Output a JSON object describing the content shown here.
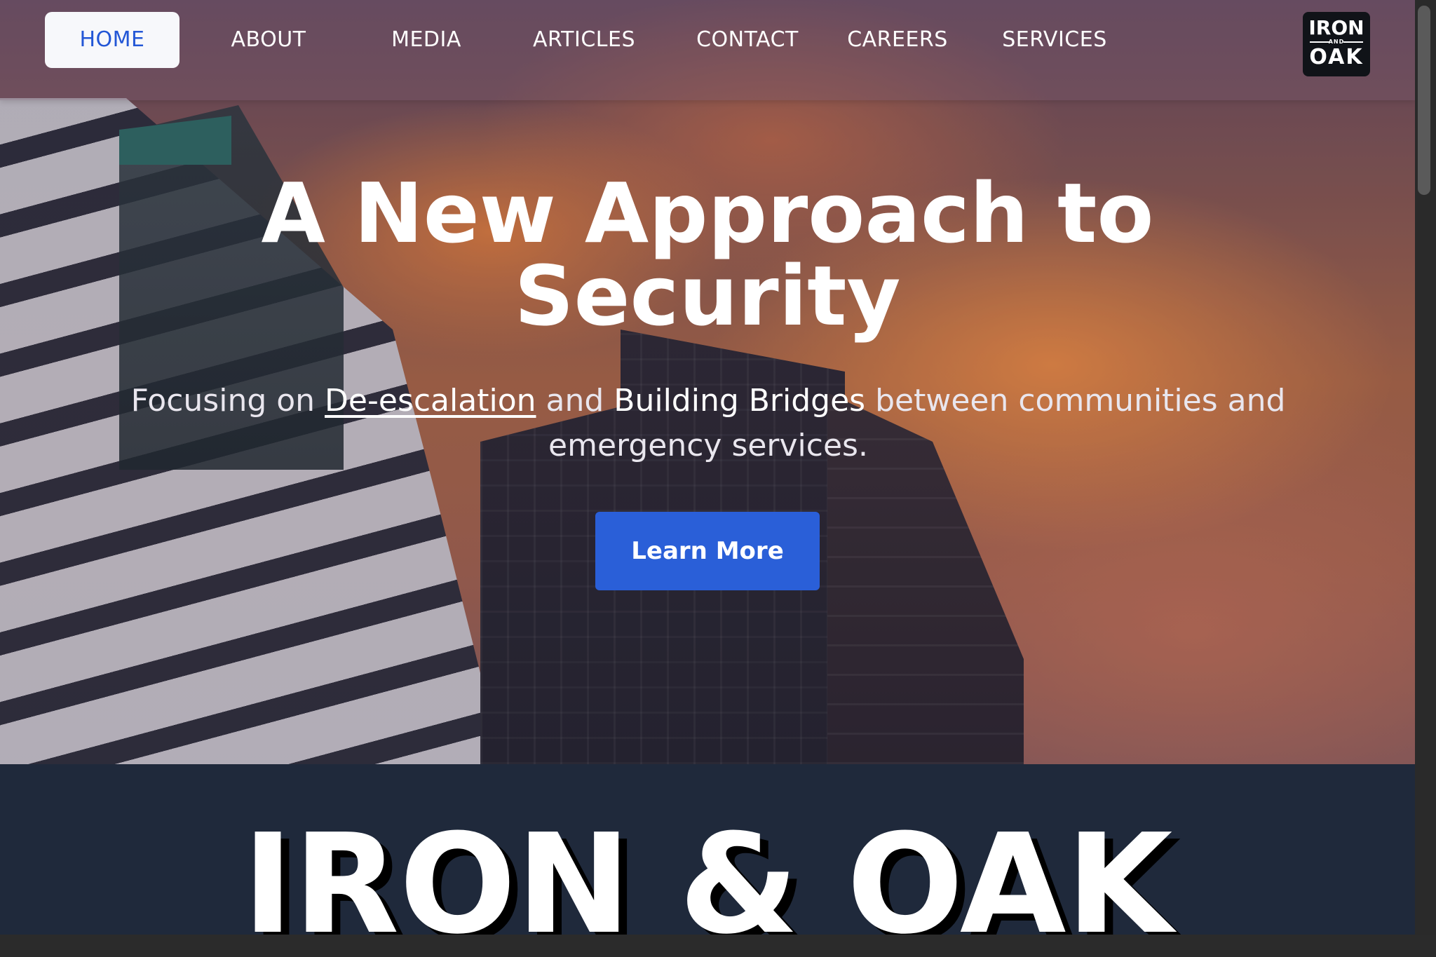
{
  "nav": {
    "items": [
      {
        "label": "HOME",
        "active": true
      },
      {
        "label": "ABOUT"
      },
      {
        "label": "MEDIA"
      },
      {
        "label": "ARTICLES"
      },
      {
        "label": "CONTACT"
      },
      {
        "label": "CAREERS"
      },
      {
        "label": "SERVICES"
      }
    ]
  },
  "logo": {
    "line1": "IRON",
    "line2": "AND",
    "line3": "OAK"
  },
  "hero": {
    "title_line1": "A New Approach to",
    "title_line2": "Security",
    "subtitle": {
      "part1": "Focusing on ",
      "underlined": "De-escalation",
      "part2": " and ",
      "bold": "Building Bridges",
      "part3": " between communities and emergency services."
    },
    "cta_label": "Learn More"
  },
  "brand": {
    "title": "IRON & OAK"
  },
  "colors": {
    "accent": "#2a5fd8",
    "active_tab_text": "#2357d6",
    "section_bg": "#1f293b"
  }
}
